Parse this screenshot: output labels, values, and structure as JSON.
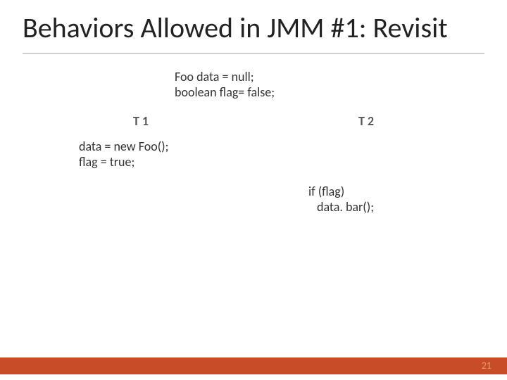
{
  "title": "Behaviors Allowed in JMM #1: Revisit",
  "init_code": {
    "line1": "Foo data = null;",
    "line2": "boolean flag= false;"
  },
  "threads": {
    "t1": {
      "label": "T 1",
      "body": {
        "line1": "data = new Foo();",
        "line2": "flag = true;"
      }
    },
    "t2": {
      "label": "T 2",
      "body": {
        "line1": "if (flag)",
        "line2": " data. bar();"
      }
    }
  },
  "page_number": "21"
}
